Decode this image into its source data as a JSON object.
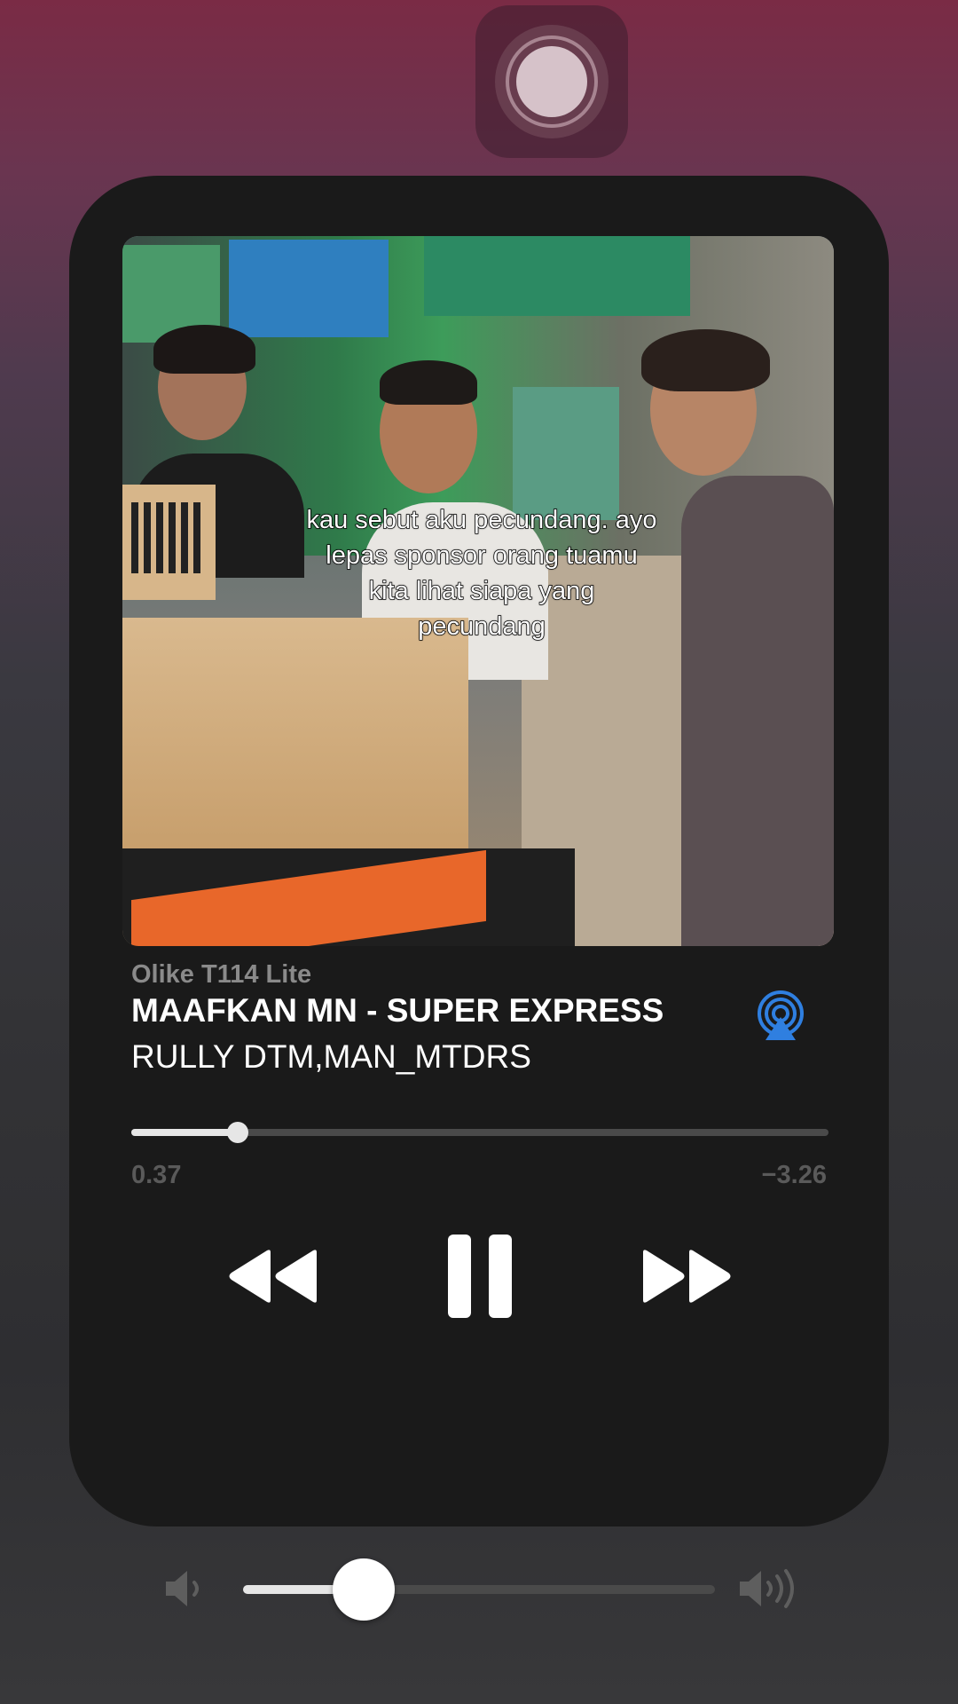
{
  "assistive_touch": {
    "icon": "assistive-touch-icon"
  },
  "artwork": {
    "caption": "kau sebut aku pecundang. ayo lepas sponsor orang tuamu kita lihat siapa yang pecundang"
  },
  "player": {
    "source": "Olike T114 Lite",
    "title": "MAAFKAN MN - SUPER EXPRESS",
    "artist": "RULLY DTM,MAN_MTDRS",
    "airplay_icon": "airplay-icon",
    "airplay_color": "#2f7fe0",
    "progress": {
      "elapsed": "0.37",
      "remaining": "−3.26",
      "fraction": 0.153
    },
    "controls": {
      "rewind_icon": "rewind-icon",
      "pause_icon": "pause-icon",
      "forward_icon": "fast-forward-icon"
    },
    "volume": {
      "low_icon": "volume-low-icon",
      "high_icon": "volume-high-icon",
      "level": 0.256
    }
  }
}
